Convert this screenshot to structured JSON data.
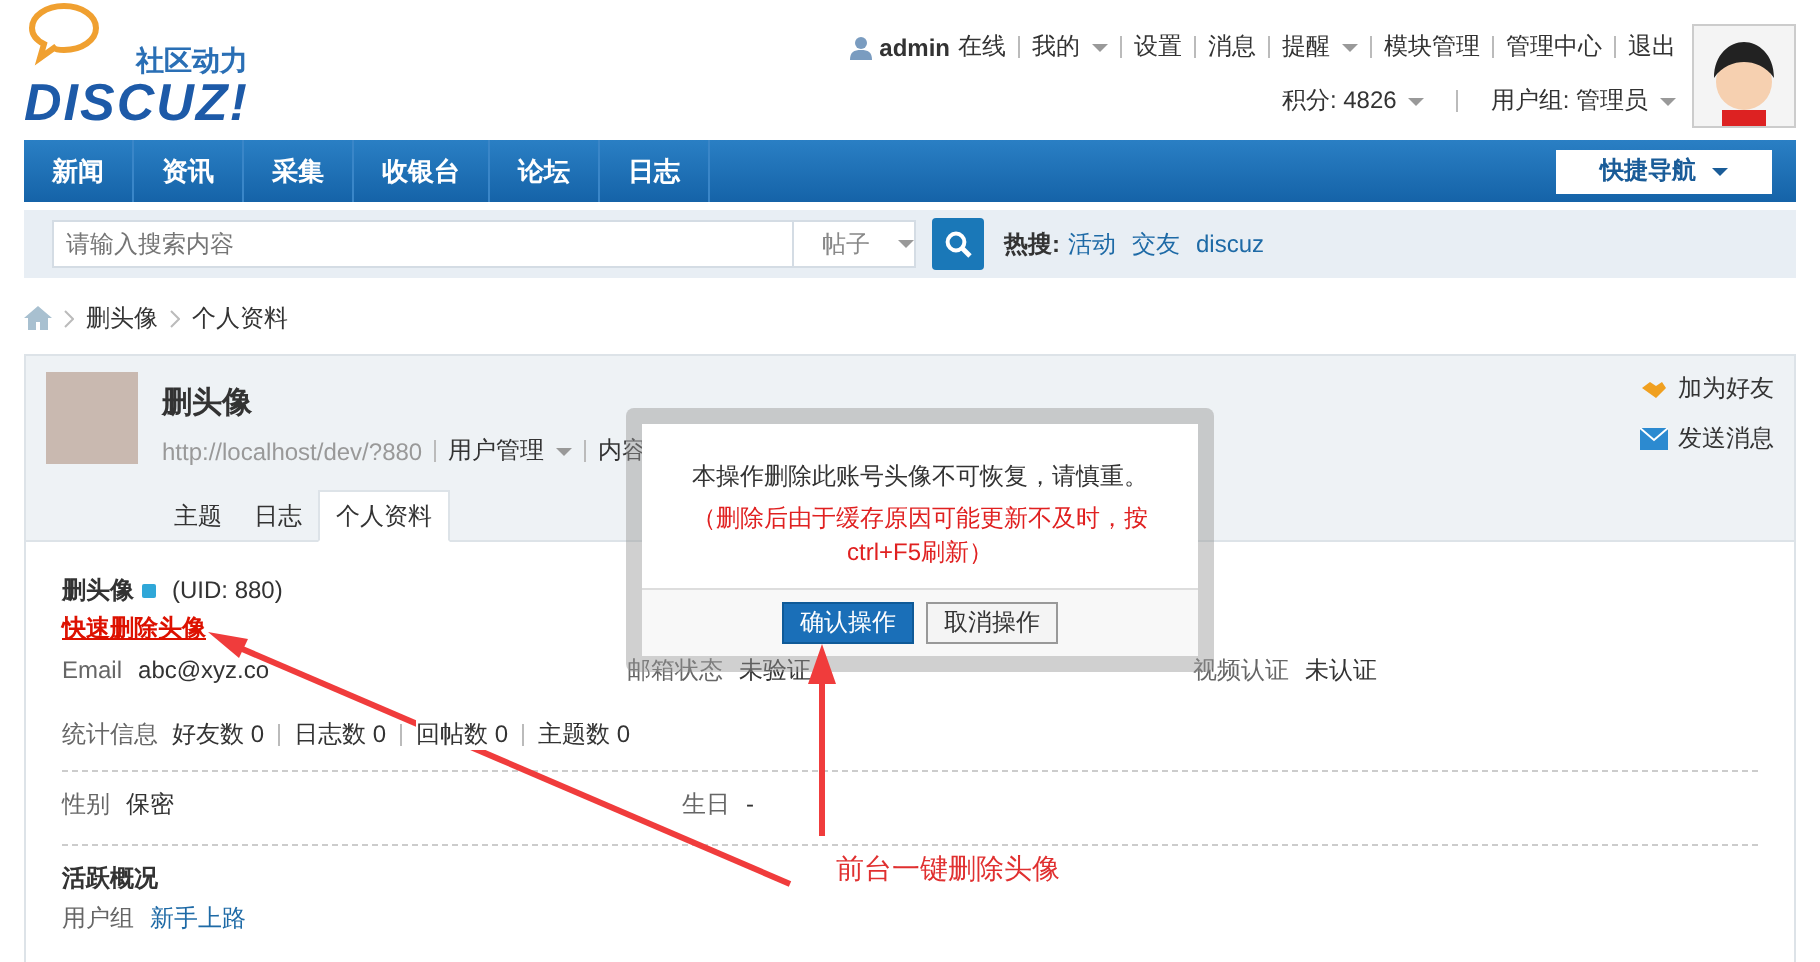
{
  "logo": {
    "tagline": "社区动力",
    "wordmark": "DISCUZ!"
  },
  "user_bar": {
    "username": "admin",
    "status": "在线",
    "links": [
      {
        "label": "我的",
        "dropdown": true
      },
      {
        "label": "设置",
        "dropdown": false
      },
      {
        "label": "消息",
        "dropdown": false
      },
      {
        "label": "提醒",
        "dropdown": true
      },
      {
        "label": "模块管理",
        "dropdown": false
      },
      {
        "label": "管理中心",
        "dropdown": false
      },
      {
        "label": "退出",
        "dropdown": false
      }
    ],
    "credits": "积分: 4826",
    "usergroup": "用户组: 管理员"
  },
  "nav": {
    "items": [
      "新闻",
      "资讯",
      "采集",
      "收银台",
      "论坛",
      "日志"
    ],
    "quick_nav": "快捷导航"
  },
  "search": {
    "placeholder": "请输入搜索内容",
    "type": "帖子",
    "hot_label": "热搜:",
    "hot": [
      "活动",
      "交友",
      "discuz"
    ]
  },
  "breadcrumb": [
    "删头像",
    "个人资料"
  ],
  "profile": {
    "name": "删头像",
    "url": "http://localhost/dev/?880",
    "menus": [
      {
        "label": "用户管理",
        "dropdown": true
      },
      {
        "label": "内容",
        "dropdown": false
      }
    ],
    "actions": [
      {
        "kind": "friend",
        "label": "加为好友"
      },
      {
        "kind": "message",
        "label": "发送消息"
      }
    ],
    "tabs": [
      {
        "label": "主题",
        "selected": false
      },
      {
        "label": "日志",
        "selected": false
      },
      {
        "label": "个人资料",
        "selected": true
      }
    ]
  },
  "content": {
    "title": "删头像",
    "uid": "(UID: 880)",
    "delete_link": "快速删除头像",
    "info_row": [
      {
        "label": "Email",
        "value": "abc@xyz.co"
      },
      {
        "label": "邮箱状态",
        "value": "未验证"
      },
      {
        "label": "视频认证",
        "value": "未认证"
      }
    ],
    "stats_label": "统计信息",
    "stats": [
      {
        "label": "好友数",
        "value": "0"
      },
      {
        "label": "日志数",
        "value": "0"
      },
      {
        "label": "回帖数",
        "value": "0"
      },
      {
        "label": "主题数",
        "value": "0"
      }
    ],
    "personal_row": [
      {
        "label": "性别",
        "value": "保密"
      },
      {
        "label": "生日",
        "value": "-"
      }
    ],
    "activity_title": "活跃概况",
    "activity": [
      {
        "label": "用户组",
        "value": "新手上路"
      }
    ]
  },
  "dialog": {
    "message": "本操作删除此账号头像不可恢复，请慎重。",
    "warning": "（删除后由于缓存原因可能更新不及时，按ctrl+F5刷新）",
    "buttons": [
      {
        "label": "确认操作",
        "primary": true
      },
      {
        "label": "取消操作",
        "primary": false
      }
    ]
  },
  "annotation": "前台一键删除头像"
}
